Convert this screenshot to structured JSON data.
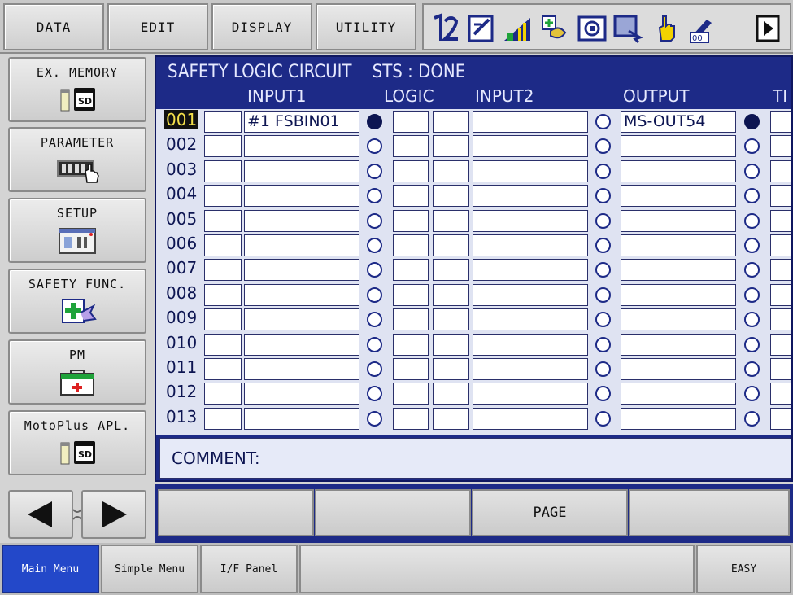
{
  "top_menu": [
    "DATA",
    "EDIT",
    "DISPLAY",
    "UTILITY"
  ],
  "toolbar_icons": [
    "job-select-icon",
    "edit-icon",
    "signal-bars-icon",
    "variable-icon",
    "camera-icon",
    "window-icon",
    "hand-icon",
    "multi-icon",
    "play-icon"
  ],
  "left_menu": [
    {
      "label": "EX. MEMORY",
      "icon": "sd-card-icon"
    },
    {
      "label": "PARAMETER",
      "icon": "parameter-icon"
    },
    {
      "label": "SETUP",
      "icon": "setup-icon"
    },
    {
      "label": "SAFETY FUNC.",
      "icon": "safety-func-icon"
    },
    {
      "label": "PM",
      "icon": "first-aid-icon"
    },
    {
      "label": "MotoPlus APL.",
      "icon": "sd-card-icon"
    }
  ],
  "screen": {
    "title": "SAFETY LOGIC CIRCUIT",
    "status": "STS : DONE",
    "columns": {
      "input1": "INPUT1",
      "logic": "LOGIC",
      "input2": "INPUT2",
      "output": "OUTPUT",
      "timer": "TI"
    },
    "selected_row": "001",
    "rows": [
      {
        "num": "001",
        "input1": "#1 FSBIN01",
        "input1_on": true,
        "input2": "",
        "input2_on": false,
        "output": "MS-OUT54",
        "output_on": true
      },
      {
        "num": "002",
        "input1": "",
        "input1_on": false,
        "input2": "",
        "input2_on": false,
        "output": "",
        "output_on": false
      },
      {
        "num": "003",
        "input1": "",
        "input1_on": false,
        "input2": "",
        "input2_on": false,
        "output": "",
        "output_on": false
      },
      {
        "num": "004",
        "input1": "",
        "input1_on": false,
        "input2": "",
        "input2_on": false,
        "output": "",
        "output_on": false
      },
      {
        "num": "005",
        "input1": "",
        "input1_on": false,
        "input2": "",
        "input2_on": false,
        "output": "",
        "output_on": false
      },
      {
        "num": "006",
        "input1": "",
        "input1_on": false,
        "input2": "",
        "input2_on": false,
        "output": "",
        "output_on": false
      },
      {
        "num": "007",
        "input1": "",
        "input1_on": false,
        "input2": "",
        "input2_on": false,
        "output": "",
        "output_on": false
      },
      {
        "num": "008",
        "input1": "",
        "input1_on": false,
        "input2": "",
        "input2_on": false,
        "output": "",
        "output_on": false
      },
      {
        "num": "009",
        "input1": "",
        "input1_on": false,
        "input2": "",
        "input2_on": false,
        "output": "",
        "output_on": false
      },
      {
        "num": "010",
        "input1": "",
        "input1_on": false,
        "input2": "",
        "input2_on": false,
        "output": "",
        "output_on": false
      },
      {
        "num": "011",
        "input1": "",
        "input1_on": false,
        "input2": "",
        "input2_on": false,
        "output": "",
        "output_on": false
      },
      {
        "num": "012",
        "input1": "",
        "input1_on": false,
        "input2": "",
        "input2_on": false,
        "output": "",
        "output_on": false
      },
      {
        "num": "013",
        "input1": "",
        "input1_on": false,
        "input2": "",
        "input2_on": false,
        "output": "",
        "output_on": false
      }
    ],
    "comment_label": "COMMENT:"
  },
  "function_keys": [
    "",
    "",
    "PAGE",
    ""
  ],
  "bottom_tabs": [
    "Main Menu",
    "Simple Menu",
    "I/F Panel",
    "",
    "EASY"
  ],
  "active_tab": "Main Menu",
  "colors": {
    "panel_blue": "#1d2a87",
    "grid_bg": "#dfe3f2",
    "active_tab": "#2348c9",
    "selected_row_text": "#f4e04a"
  }
}
